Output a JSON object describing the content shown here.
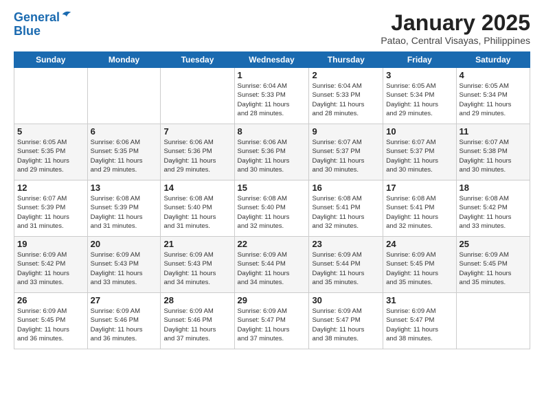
{
  "logo": {
    "line1": "General",
    "line2": "Blue"
  },
  "title": "January 2025",
  "subtitle": "Patao, Central Visayas, Philippines",
  "headers": [
    "Sunday",
    "Monday",
    "Tuesday",
    "Wednesday",
    "Thursday",
    "Friday",
    "Saturday"
  ],
  "weeks": [
    [
      {
        "day": "",
        "info": ""
      },
      {
        "day": "",
        "info": ""
      },
      {
        "day": "",
        "info": ""
      },
      {
        "day": "1",
        "info": "Sunrise: 6:04 AM\nSunset: 5:33 PM\nDaylight: 11 hours\nand 28 minutes."
      },
      {
        "day": "2",
        "info": "Sunrise: 6:04 AM\nSunset: 5:33 PM\nDaylight: 11 hours\nand 28 minutes."
      },
      {
        "day": "3",
        "info": "Sunrise: 6:05 AM\nSunset: 5:34 PM\nDaylight: 11 hours\nand 29 minutes."
      },
      {
        "day": "4",
        "info": "Sunrise: 6:05 AM\nSunset: 5:34 PM\nDaylight: 11 hours\nand 29 minutes."
      }
    ],
    [
      {
        "day": "5",
        "info": "Sunrise: 6:05 AM\nSunset: 5:35 PM\nDaylight: 11 hours\nand 29 minutes."
      },
      {
        "day": "6",
        "info": "Sunrise: 6:06 AM\nSunset: 5:35 PM\nDaylight: 11 hours\nand 29 minutes."
      },
      {
        "day": "7",
        "info": "Sunrise: 6:06 AM\nSunset: 5:36 PM\nDaylight: 11 hours\nand 29 minutes."
      },
      {
        "day": "8",
        "info": "Sunrise: 6:06 AM\nSunset: 5:36 PM\nDaylight: 11 hours\nand 30 minutes."
      },
      {
        "day": "9",
        "info": "Sunrise: 6:07 AM\nSunset: 5:37 PM\nDaylight: 11 hours\nand 30 minutes."
      },
      {
        "day": "10",
        "info": "Sunrise: 6:07 AM\nSunset: 5:37 PM\nDaylight: 11 hours\nand 30 minutes."
      },
      {
        "day": "11",
        "info": "Sunrise: 6:07 AM\nSunset: 5:38 PM\nDaylight: 11 hours\nand 30 minutes."
      }
    ],
    [
      {
        "day": "12",
        "info": "Sunrise: 6:07 AM\nSunset: 5:39 PM\nDaylight: 11 hours\nand 31 minutes."
      },
      {
        "day": "13",
        "info": "Sunrise: 6:08 AM\nSunset: 5:39 PM\nDaylight: 11 hours\nand 31 minutes."
      },
      {
        "day": "14",
        "info": "Sunrise: 6:08 AM\nSunset: 5:40 PM\nDaylight: 11 hours\nand 31 minutes."
      },
      {
        "day": "15",
        "info": "Sunrise: 6:08 AM\nSunset: 5:40 PM\nDaylight: 11 hours\nand 32 minutes."
      },
      {
        "day": "16",
        "info": "Sunrise: 6:08 AM\nSunset: 5:41 PM\nDaylight: 11 hours\nand 32 minutes."
      },
      {
        "day": "17",
        "info": "Sunrise: 6:08 AM\nSunset: 5:41 PM\nDaylight: 11 hours\nand 32 minutes."
      },
      {
        "day": "18",
        "info": "Sunrise: 6:08 AM\nSunset: 5:42 PM\nDaylight: 11 hours\nand 33 minutes."
      }
    ],
    [
      {
        "day": "19",
        "info": "Sunrise: 6:09 AM\nSunset: 5:42 PM\nDaylight: 11 hours\nand 33 minutes."
      },
      {
        "day": "20",
        "info": "Sunrise: 6:09 AM\nSunset: 5:43 PM\nDaylight: 11 hours\nand 33 minutes."
      },
      {
        "day": "21",
        "info": "Sunrise: 6:09 AM\nSunset: 5:43 PM\nDaylight: 11 hours\nand 34 minutes."
      },
      {
        "day": "22",
        "info": "Sunrise: 6:09 AM\nSunset: 5:44 PM\nDaylight: 11 hours\nand 34 minutes."
      },
      {
        "day": "23",
        "info": "Sunrise: 6:09 AM\nSunset: 5:44 PM\nDaylight: 11 hours\nand 35 minutes."
      },
      {
        "day": "24",
        "info": "Sunrise: 6:09 AM\nSunset: 5:45 PM\nDaylight: 11 hours\nand 35 minutes."
      },
      {
        "day": "25",
        "info": "Sunrise: 6:09 AM\nSunset: 5:45 PM\nDaylight: 11 hours\nand 35 minutes."
      }
    ],
    [
      {
        "day": "26",
        "info": "Sunrise: 6:09 AM\nSunset: 5:45 PM\nDaylight: 11 hours\nand 36 minutes."
      },
      {
        "day": "27",
        "info": "Sunrise: 6:09 AM\nSunset: 5:46 PM\nDaylight: 11 hours\nand 36 minutes."
      },
      {
        "day": "28",
        "info": "Sunrise: 6:09 AM\nSunset: 5:46 PM\nDaylight: 11 hours\nand 37 minutes."
      },
      {
        "day": "29",
        "info": "Sunrise: 6:09 AM\nSunset: 5:47 PM\nDaylight: 11 hours\nand 37 minutes."
      },
      {
        "day": "30",
        "info": "Sunrise: 6:09 AM\nSunset: 5:47 PM\nDaylight: 11 hours\nand 38 minutes."
      },
      {
        "day": "31",
        "info": "Sunrise: 6:09 AM\nSunset: 5:47 PM\nDaylight: 11 hours\nand 38 minutes."
      },
      {
        "day": "",
        "info": ""
      }
    ]
  ]
}
